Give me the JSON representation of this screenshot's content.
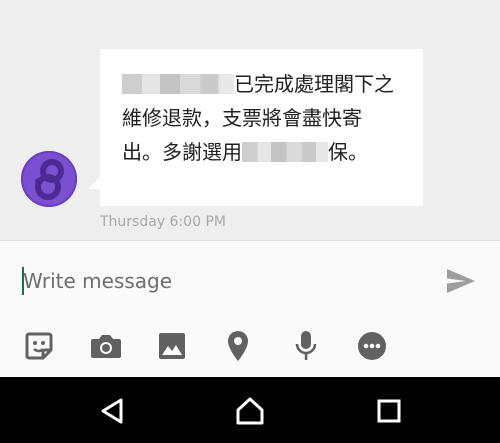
{
  "conversation": {
    "message": {
      "text_part1": "已完成處理閣下之維修退款，支票將會盡快寄出。多謝選用",
      "text_part2": "保。",
      "timestamp": "Thursday 6:00 PM"
    }
  },
  "composer": {
    "placeholder": "Write message",
    "send_icon": "send-icon"
  },
  "toolbar": {
    "icons": [
      "sticker-icon",
      "camera-icon",
      "image-icon",
      "location-icon",
      "microphone-icon",
      "more-icon"
    ]
  },
  "navbar": {
    "icons": [
      "back-icon",
      "home-icon",
      "recents-icon"
    ]
  },
  "colors": {
    "avatar": "#6c3fbf",
    "background": "#eeeeee",
    "icon": "#616161",
    "cursor": "#1a6b5a"
  }
}
